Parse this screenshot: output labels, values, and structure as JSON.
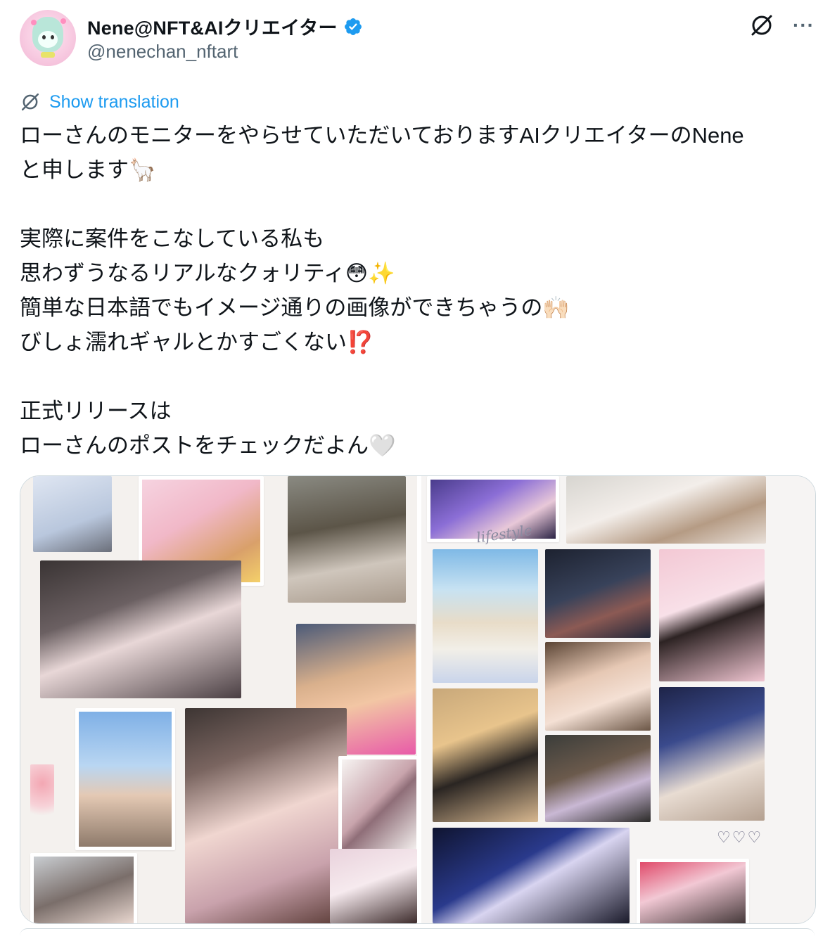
{
  "author": {
    "display_name": "Nene@NFT&AIクリエイター",
    "handle": "@nenechan_nftart",
    "verified": true
  },
  "actions": {
    "grok_icon": "grok-icon",
    "more_label": "···"
  },
  "translate": {
    "label": "Show translation"
  },
  "tweet": {
    "text": "ローさんのモニターをやらせていただいておりますAIクリエイターのNene\nと申します🦙\n\n実際に案件をこなしている私も\n思わずうなるリアルなクォリティ😳✨\n簡単な日本語でもイメージ通りの画像ができちゃうの🙌🏻\nびしょ濡れギャルとかすごくない⁉️\n\n正式リリースは\nローさんのポストをチェックだよん🤍"
  },
  "media": {
    "collage_left_caption": "",
    "collage_right_caption": "lifestyle",
    "hearts": "♡♡♡",
    "colors": {
      "border": "#cfd9de",
      "collage_bg": "#f4f1ee"
    }
  },
  "colors": {
    "link": "#1d9bf0",
    "secondary_text": "#536471",
    "verified_badge": "#1d9bf0"
  }
}
